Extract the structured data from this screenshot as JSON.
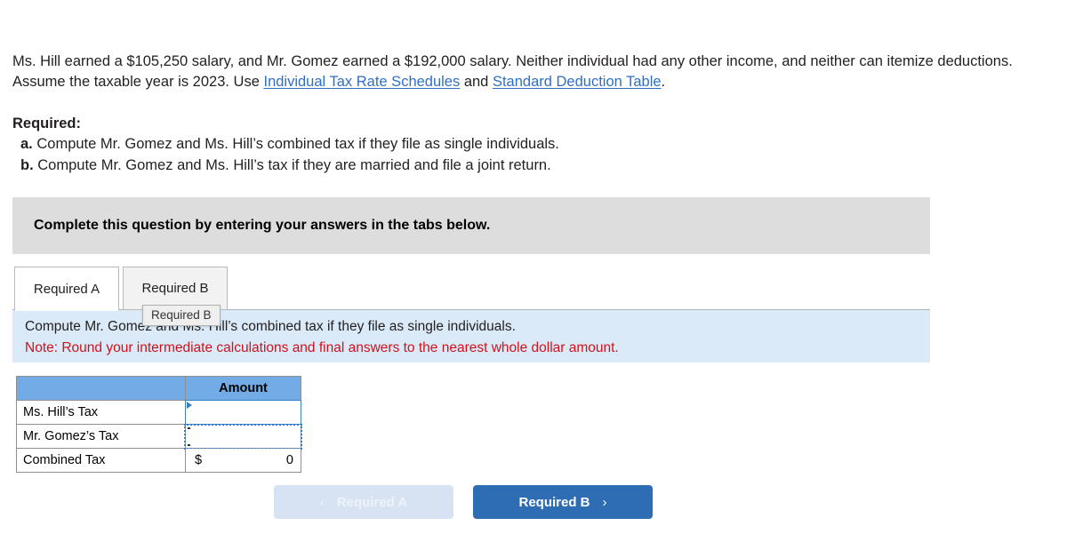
{
  "problem": {
    "segments": [
      {
        "type": "text",
        "value": "Ms. Hill earned a $105,250 salary, and Mr. Gomez earned a $192,000 salary. Neither individual had any other income, and neither can itemize deductions. Assume the taxable year is 2023. Use "
      },
      {
        "type": "link",
        "value": "Individual Tax Rate Schedules"
      },
      {
        "type": "text",
        "value": " and "
      },
      {
        "type": "link",
        "value": "Standard Deduction Table"
      },
      {
        "type": "text",
        "value": "."
      }
    ],
    "text_part_1": "Ms. Hill earned a $105,250 salary, and Mr. Gomez earned a $192,000 salary. Neither individual had any other income, and neither can itemize deductions. Assume the taxable year is 2023. Use ",
    "link_1": "Individual Tax Rate Schedules",
    "text_part_2": " and ",
    "link_2": "Standard Deduction Table",
    "text_part_3": "."
  },
  "required": {
    "title": "Required:",
    "item_a_letter": "a.",
    "item_a_text": "Compute Mr. Gomez and Ms. Hill’s combined tax if they file as single individuals.",
    "item_b_letter": "b.",
    "item_b_text": "Compute Mr. Gomez and Ms. Hill’s tax if they are married and file a joint return."
  },
  "banner": {
    "text": "Complete this question by entering your answers in the tabs below."
  },
  "tabs": [
    {
      "label": "Required A",
      "active": true
    },
    {
      "label": "Required B",
      "active": false
    }
  ],
  "tooltip": {
    "text": "Required B"
  },
  "note_panel": {
    "question": "Compute Mr. Gomez and Ms. Hill’s combined tax if they file as single individuals.",
    "note": "Note: Round your intermediate calculations and final answers to the nearest whole dollar amount."
  },
  "answer_table": {
    "headers": [
      "",
      "Amount"
    ],
    "rows": [
      {
        "label": "Ms. Hill’s Tax",
        "currency": "",
        "value": "",
        "state": "selected"
      },
      {
        "label": "Mr. Gomez’s Tax",
        "currency": "",
        "value": "",
        "state": "marquee"
      },
      {
        "label": "Combined Tax",
        "currency": "$",
        "value": "0",
        "state": "computed"
      }
    ]
  },
  "nav_buttons": {
    "prev_label": "Required A",
    "prev_chevron": "‹",
    "next_label": "Required B",
    "next_chevron": "›"
  },
  "colors": {
    "banner_gray": "#dddddd",
    "note_blue": "#daeaf8",
    "table_header_blue": "#72abe6",
    "note_red": "#d0121b",
    "link_blue": "#2f6fc3",
    "primary_button": "#2e6db4",
    "disabled_button": "#d7e3f2"
  }
}
